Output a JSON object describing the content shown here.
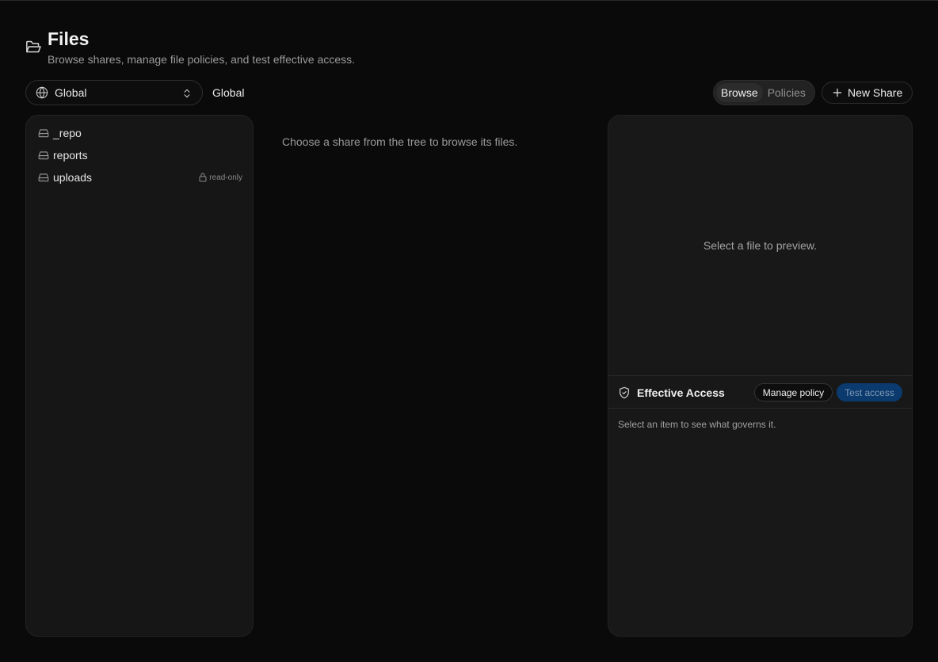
{
  "header": {
    "title": "Files",
    "subtitle": "Browse shares, manage file policies, and test effective access."
  },
  "scope": {
    "selected": "Global",
    "label": "Global"
  },
  "view_toggle": {
    "options": [
      "Browse",
      "Policies"
    ],
    "active": "Browse"
  },
  "actions": {
    "new_share": "New Share"
  },
  "tree": {
    "items": [
      {
        "name": "_repo",
        "badge": ""
      },
      {
        "name": "reports",
        "badge": ""
      },
      {
        "name": "uploads",
        "badge": "read-only"
      }
    ]
  },
  "browser": {
    "empty_message": "Choose a share from the tree to browse its files."
  },
  "preview": {
    "empty_message": "Select a file to preview."
  },
  "effective_access": {
    "heading": "Effective Access",
    "manage_label": "Manage policy",
    "test_label": "Test access",
    "hint": "Select an item to see what governs it."
  },
  "colors": {
    "background": "#0a0a0a",
    "panel": "#161616",
    "accent_button": "#0b3a6e"
  }
}
